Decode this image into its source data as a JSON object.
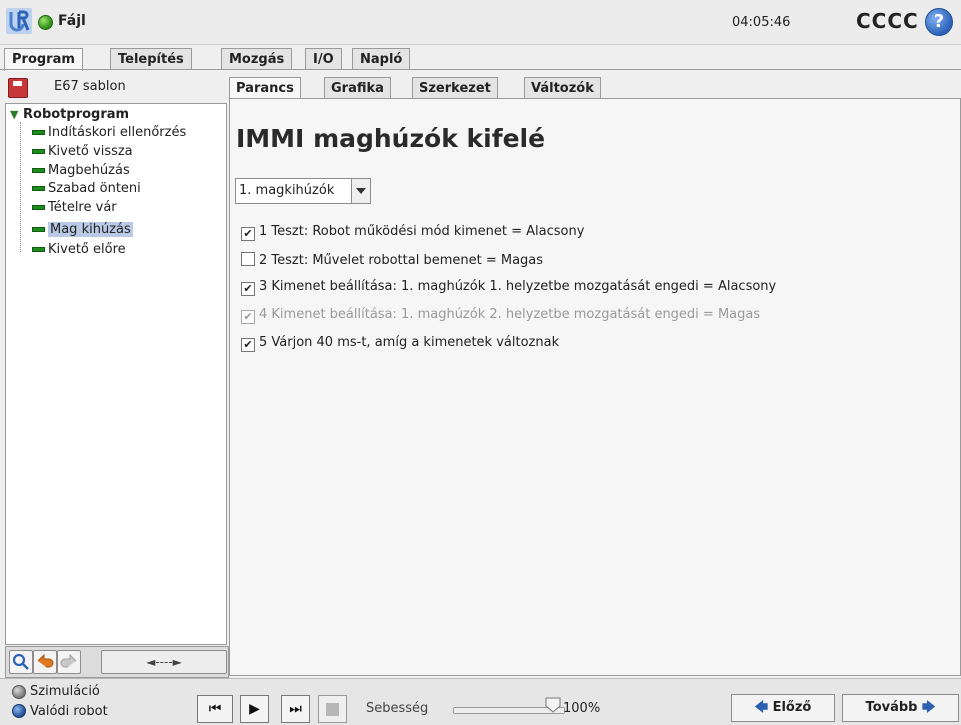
{
  "header": {
    "file_label": "Fájl",
    "time": "04:05:46",
    "robot_name": "CCCC",
    "help_glyph": "?"
  },
  "main_tabs": [
    {
      "label": "Program",
      "active": true
    },
    {
      "label": "Telepítés",
      "active": false
    },
    {
      "label": "Mozgás",
      "active": false
    },
    {
      "label": "I/O",
      "active": false
    },
    {
      "label": "Napló",
      "active": false
    }
  ],
  "left": {
    "program_name": "E67 sablon",
    "tree": {
      "root": "Robotprogram",
      "items": [
        {
          "label": "Indításkori ellenőrzés",
          "selected": false
        },
        {
          "label": "Kivető vissza",
          "selected": false
        },
        {
          "label": "Magbehúzás",
          "selected": false
        },
        {
          "label": "Szabad önteni",
          "selected": false
        },
        {
          "label": "Tételre vár",
          "selected": false
        },
        {
          "label": "Mag kihúzás",
          "selected": true
        },
        {
          "label": "Kivető előre",
          "selected": false
        }
      ]
    },
    "tools": {
      "arrows": "◄----►"
    }
  },
  "sub_tabs": [
    {
      "label": "Parancs",
      "active": true
    },
    {
      "label": "Grafika",
      "active": false
    },
    {
      "label": "Szerkezet",
      "active": false
    },
    {
      "label": "Változók",
      "active": false
    }
  ],
  "content": {
    "title": "IMMI maghúzók kifelé",
    "dropdown_value": "1. magkihúzók",
    "rows": [
      {
        "text": "1 Teszt: Robot működési mód kimenet = Alacsony",
        "checked": true,
        "dim": false
      },
      {
        "text": "2 Teszt: Művelet robottal bemenet = Magas",
        "checked": false,
        "dim": false
      },
      {
        "text": "3 Kimenet beállítása: 1. maghúzók 1. helyzetbe mozgatását engedi = Alacsony",
        "checked": true,
        "dim": false
      },
      {
        "text": "4 Kimenet beállítása: 1. maghúzók 2. helyzetbe mozgatását engedi = Magas",
        "checked": true,
        "dim": true
      },
      {
        "text": "5 Várjon 40 ms-t, amíg a kimenetek változnak",
        "checked": true,
        "dim": false
      }
    ]
  },
  "footer": {
    "simulation": "Szimuláció",
    "real_robot": "Valódi robot",
    "speed_label": "Sebesség",
    "speed_value": "100%",
    "speed_level": 1.0,
    "prev": "Előző",
    "next": "Tovább"
  },
  "colors": {
    "accent_blue": "#2c63b8",
    "tree_green": "#1f8a1f",
    "selection": "#b9c9e6"
  }
}
